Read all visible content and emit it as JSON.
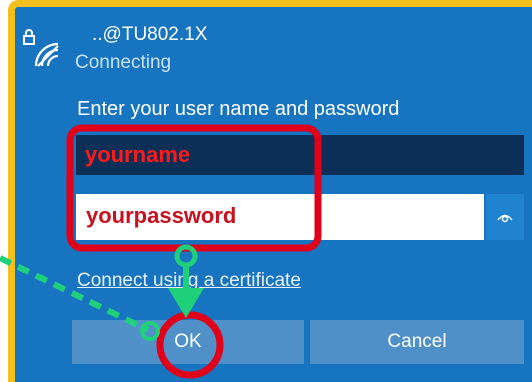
{
  "dialog": {
    "network_name": "..@TU802.1X",
    "status": "Connecting",
    "prompt": "Enter your user name and password",
    "username_value": "yourname",
    "password_value": "yourpassword",
    "certificate_link": "Connect using a certificate",
    "ok_label": "OK",
    "cancel_label": "Cancel"
  },
  "icons": {
    "network": "wifi-lock-icon",
    "reveal": "eye-icon"
  },
  "colors": {
    "panel_bg": "#1774c1",
    "annotation_red": "#e0001a",
    "annotation_green": "#1fd07a",
    "frame_yellow": "#f4c01e"
  }
}
